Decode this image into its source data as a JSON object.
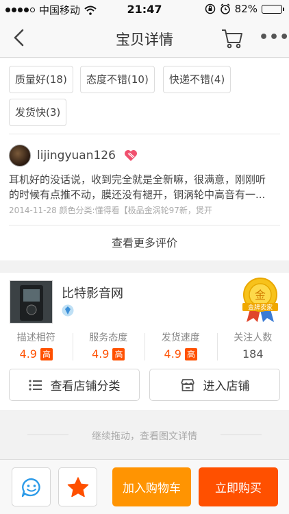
{
  "status_bar": {
    "carrier": "中国移动",
    "time": "21:47",
    "battery": "82%",
    "battery_level": 0.82
  },
  "nav": {
    "title": "宝贝详情",
    "back_icon": "chevron-left-icon",
    "cart_icon": "cart-icon",
    "more_icon": "more-icon",
    "more_glyph": "•••"
  },
  "reviews": {
    "tags": [
      "质量好(18)",
      "态度不错(10)",
      "快递不错(4)",
      "发货快(3)"
    ],
    "reviewer": {
      "username": "lijingyuan126"
    },
    "text_line1": "耳机好的没话说，收到完全就是全新嘛，很满意，刚刚听",
    "text_line2": "的时候有点推不动，膜还没有褪开，铜涡轮中高音有一...",
    "meta": "2014-11-28 颜色分类:懂得看【极品金涡轮97新，煲开",
    "more_label": "查看更多评价"
  },
  "shop": {
    "name": "比特影音网",
    "medal_text": "金",
    "medal_ribbon": "金牌卖家",
    "ratings": [
      {
        "label": "描述相符",
        "value": "4.9",
        "badge": "高"
      },
      {
        "label": "服务态度",
        "value": "4.9",
        "badge": "高"
      },
      {
        "label": "发货速度",
        "value": "4.9",
        "badge": "高"
      },
      {
        "label": "关注人数",
        "value": "184",
        "badge": ""
      }
    ],
    "categories_button": "查看店铺分类",
    "enter_button": "进入店铺"
  },
  "continue_hint": "继续拖动，查看图文详情",
  "bottom_bar": {
    "add_to_cart": "加入购物车",
    "buy_now": "立即购买",
    "cart_color": "#ff9402",
    "buy_color": "#ff5000"
  },
  "colors": {
    "accent": "#ff5000",
    "gold": "#f5b400"
  }
}
